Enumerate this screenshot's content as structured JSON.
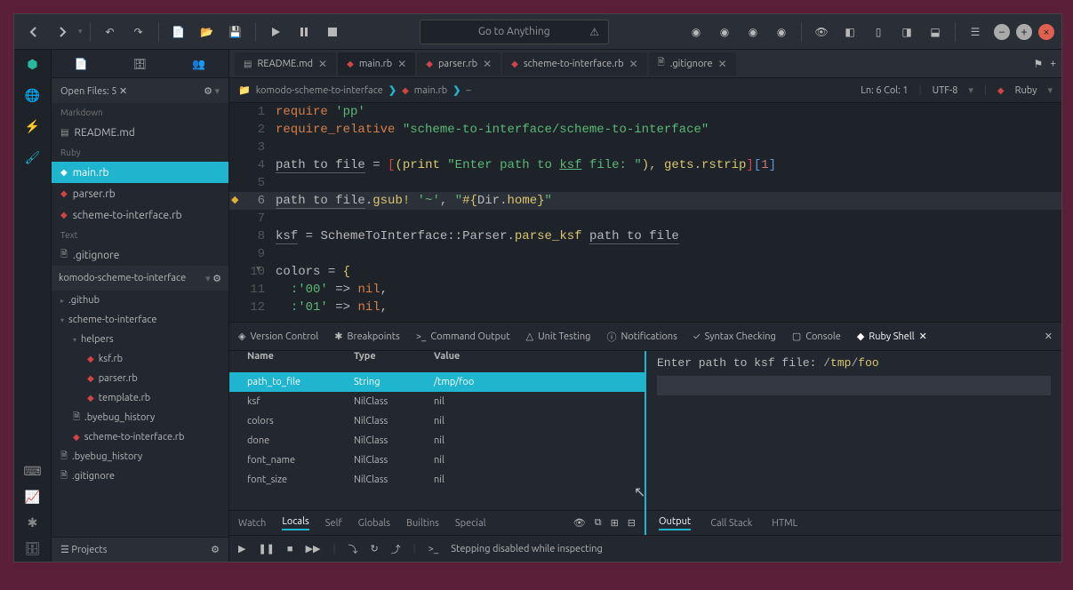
{
  "toolbar": {
    "search_placeholder": "Go to Anything"
  },
  "sidebar": {
    "openfiles": {
      "label": "Open Files: 5"
    },
    "sections": {
      "markdown": {
        "label": "Markdown",
        "items": [
          "README.md"
        ]
      },
      "ruby": {
        "label": "Ruby",
        "items": [
          "main.rb",
          "parser.rb",
          "scheme-to-interface.rb"
        ]
      },
      "text": {
        "label": "Text",
        "items": [
          ".gitignore"
        ]
      }
    },
    "project": {
      "name": "komodo-scheme-to-interface",
      "tree": [
        {
          "label": ".github",
          "type": "folder",
          "level": 0
        },
        {
          "label": "scheme-to-interface",
          "type": "folder",
          "level": 0
        },
        {
          "label": "helpers",
          "type": "folder",
          "level": 1
        },
        {
          "label": "ksf.rb",
          "type": "ruby",
          "level": 2
        },
        {
          "label": "parser.rb",
          "type": "ruby",
          "level": 2
        },
        {
          "label": "template.rb",
          "type": "ruby",
          "level": 2
        },
        {
          "label": ".byebug_history",
          "type": "file",
          "level": 1
        },
        {
          "label": "scheme-to-interface.rb",
          "type": "ruby",
          "level": 1
        },
        {
          "label": ".byebug_history",
          "type": "file",
          "level": 0
        },
        {
          "label": ".gitignore",
          "type": "file",
          "level": 0
        }
      ]
    },
    "projects_label": "Projects"
  },
  "tabs": [
    {
      "label": "README.md",
      "icon": "md"
    },
    {
      "label": "main.rb",
      "icon": "ruby",
      "active": true
    },
    {
      "label": "parser.rb",
      "icon": "ruby"
    },
    {
      "label": "scheme-to-interface.rb",
      "icon": "ruby"
    },
    {
      "label": ".gitignore",
      "icon": "txt"
    }
  ],
  "breadcrumb": {
    "folder": "komodo-scheme-to-interface",
    "file": "main.rb",
    "status": {
      "pos": "Ln: 6 Col: 1",
      "encoding": "UTF-8",
      "lang": "Ruby"
    }
  },
  "code": {
    "lines": [
      {
        "n": 1,
        "html": "<span class='kw'>require</span> <span class='str'>'pp'</span>"
      },
      {
        "n": 2,
        "html": "<span class='kw'>require_relative</span> <span class='str'>\"scheme-to-interface/scheme-to-interface\"</span>"
      },
      {
        "n": 3,
        "html": ""
      },
      {
        "n": 4,
        "html": "<span class='var under'>path to file</span> <span class='op'>=</span> <span class='bracket-r'>[</span><span class='bracket-y'>(</span><span class='fn'>print</span> <span class='str'>\"Enter path to <u>ksf</u> file: \"</span><span class='bracket-y'>)</span><span class='punct'>,</span> <span class='fn'>gets</span><span class='punct'>.</span><span class='fn'>rstrip</span><span class='bracket-r'>]</span><span class='bracket-b'>[</span><span class='num'>1</span><span class='bracket-b'>]</span>"
      },
      {
        "n": 5,
        "html": ""
      },
      {
        "n": 6,
        "html": "<span class='var under'>path to file</span><span class='punct'>.</span><span class='fn'>gsub!</span> <span class='str'>'~'</span><span class='punct'>,</span> <span class='str'>\"</span><span class='bracket-y'>#{</span><span class='var'>Dir</span><span class='punct'>.</span><span class='fn'>home</span><span class='bracket-y'>}</span><span class='str'>\"</span>",
        "current": true,
        "breakpoint": true
      },
      {
        "n": 7,
        "html": ""
      },
      {
        "n": 8,
        "html": "<span class='var under'>ksf</span> <span class='op'>=</span> <span class='var'>SchemeToInterface</span><span class='punct'>::</span><span class='var'>Parser</span><span class='punct'>.</span><span class='fn'>parse_ksf</span> <span class='var under'>path to file</span>"
      },
      {
        "n": 9,
        "html": ""
      },
      {
        "n": 10,
        "html": "<span class='var'>colors</span> <span class='op'>=</span> <span class='bracket-y'>{</span>",
        "fold": true
      },
      {
        "n": 11,
        "html": "  <span class='sym'>:</span><span class='str'>'00'</span> <span class='op'>=&gt;</span> <span class='nil'>nil</span><span class='punct'>,</span>"
      },
      {
        "n": 12,
        "html": "  <span class='sym'>:</span><span class='str'>'01'</span> <span class='op'>=&gt;</span> <span class='nil'>nil</span><span class='punct'>,</span>"
      }
    ]
  },
  "bottom": {
    "tabs": [
      "Version Control",
      "Breakpoints",
      "Command Output",
      "Unit Testing",
      "Notifications",
      "Syntax Checking",
      "Console",
      "Ruby Shell"
    ],
    "vars": {
      "headers": [
        "Name",
        "Type",
        "Value"
      ],
      "rows": [
        {
          "name": "path_to_file",
          "type": "String",
          "value": "/tmp/foo",
          "sel": true
        },
        {
          "name": "ksf",
          "type": "NilClass",
          "value": "nil"
        },
        {
          "name": "colors",
          "type": "NilClass",
          "value": "nil"
        },
        {
          "name": "done",
          "type": "NilClass",
          "value": "nil"
        },
        {
          "name": "font_name",
          "type": "NilClass",
          "value": "nil"
        },
        {
          "name": "font_size",
          "type": "NilClass",
          "value": "nil"
        }
      ],
      "footer": [
        "Watch",
        "Locals",
        "Self",
        "Globals",
        "Builtins",
        "Special"
      ]
    },
    "shell": {
      "prompt": "Enter path to ksf file: ",
      "input": "/tmp/foo",
      "footer": [
        "Output",
        "Call Stack",
        "HTML"
      ]
    }
  },
  "debugbar": {
    "status": "Stepping disabled while inspecting"
  }
}
